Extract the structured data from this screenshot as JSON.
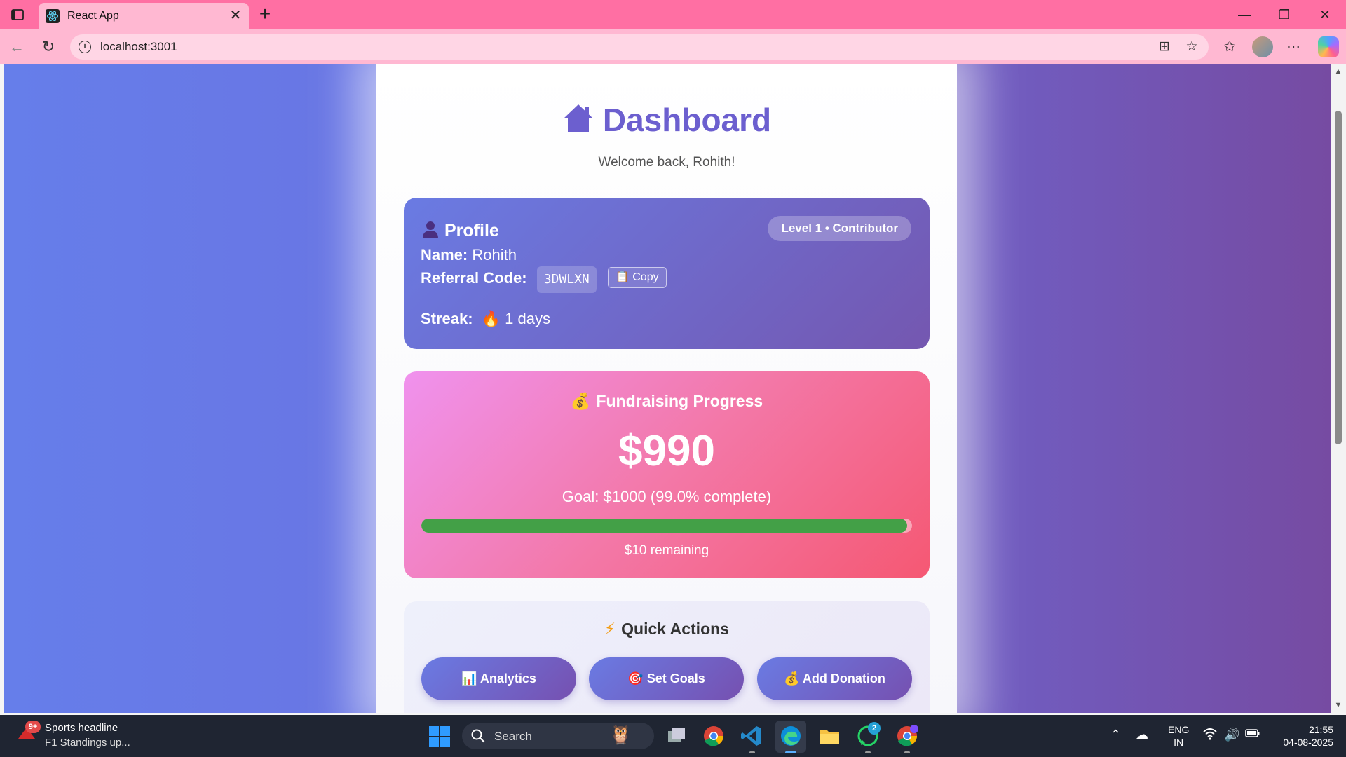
{
  "browser": {
    "tab_title": "React App",
    "url": "localhost:3001"
  },
  "page": {
    "title": "Dashboard",
    "welcome": "Welcome back, Rohith!"
  },
  "profile": {
    "heading": "Profile",
    "level_badge": "Level 1 • Contributor",
    "name_label": "Name:",
    "name_value": "Rohith",
    "referral_label": "Referral Code:",
    "referral_code": "3DWLXN",
    "copy_label": "Copy",
    "streak_label": "Streak:",
    "streak_value": "1 days"
  },
  "fundraising": {
    "heading": "Fundraising Progress",
    "amount": "$990",
    "goal_text": "Goal: $1000 (99.0% complete)",
    "progress_fraction": 0.99,
    "remaining_text": "$10 remaining"
  },
  "quick_actions": {
    "heading": "Quick Actions",
    "buttons": [
      {
        "label": "Analytics",
        "icon": "bar-chart-icon"
      },
      {
        "label": "Set Goals",
        "icon": "target-icon"
      },
      {
        "label": "Add Donation",
        "icon": "money-bag-icon"
      }
    ]
  },
  "taskbar": {
    "news_badge": "9+",
    "news_title": "Sports headline",
    "news_subtitle": "F1 Standings up...",
    "search_label": "Search",
    "whatsapp_badge": "2",
    "lang_line1": "ENG",
    "lang_line2": "IN",
    "time": "21:55",
    "date": "04-08-2025"
  },
  "colors": {
    "accent": "#6c5fcf",
    "progress_fill": "#43a047",
    "tab_bar": "#ff6fa3"
  }
}
